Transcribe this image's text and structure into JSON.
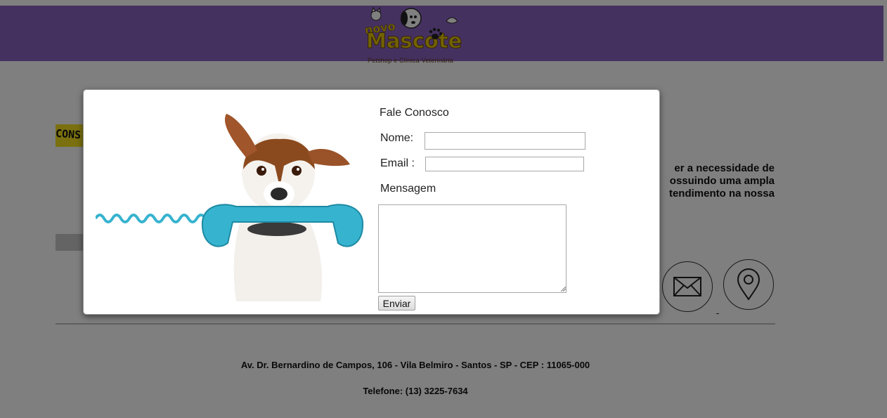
{
  "header": {
    "logo_text_top": "novo",
    "logo_text_main": "Mascote",
    "logo_subtitle": "Petshop e Clínica Veterinária",
    "color": "#8a63c0"
  },
  "background": {
    "banner_left_text": "CONS",
    "paragraph_lines": [
      "er a necessidade de",
      "ossuindo uma ampla",
      "tendimento na nossa"
    ],
    "address_line": "Av. Dr. Bernardino de Campos, 106 - Vila Belmiro - Santos - SP - CEP : 11065-000",
    "phone_line": "Telefone: (13) 3225-7634"
  },
  "icons": {
    "mail": "envelope-icon",
    "location": "map-pin-icon"
  },
  "modal": {
    "title": "Fale Conosco",
    "nome_label": "Nome:",
    "email_label": "Email :",
    "mensagem_label": "Mensagem",
    "nome_value": "",
    "email_value": "",
    "mensagem_value": "",
    "submit_label": "Enviar"
  },
  "colors": {
    "overlay": "rgba(0,0,0,0.5)",
    "phone": "#36b3cf",
    "banner": "#f5e11e"
  }
}
